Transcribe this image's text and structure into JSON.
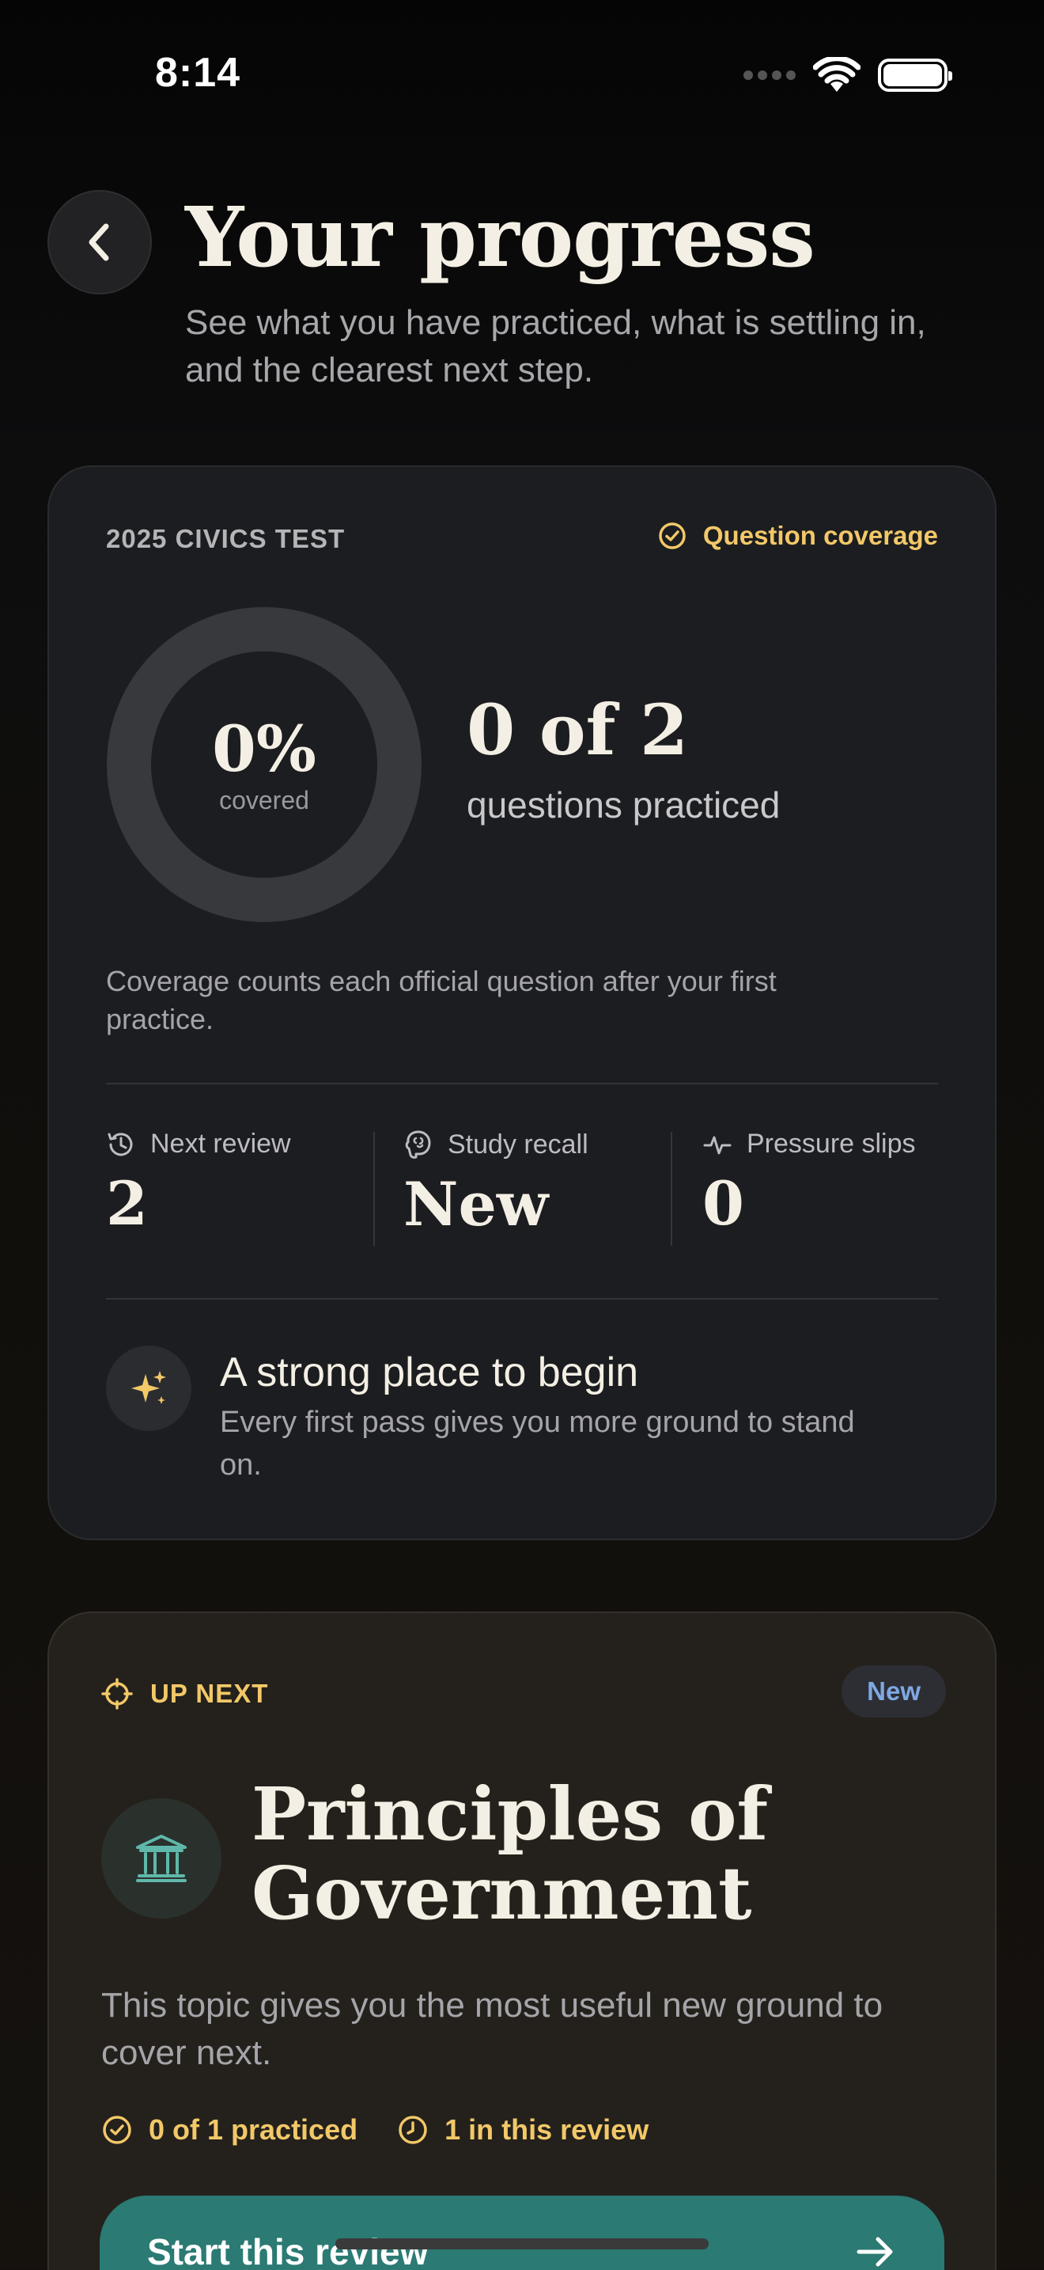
{
  "status_bar": {
    "time": "8:14"
  },
  "header": {
    "title": "Your progress",
    "subtitle": "See what you have practiced, what is settling in, and the clearest next step."
  },
  "progress_card": {
    "label": "2025 CIVICS TEST",
    "coverage_tag": "Question coverage",
    "ring": {
      "percent_text": "0%",
      "caption": "covered",
      "coverage_fraction": 0
    },
    "count": "0 of 2",
    "count_caption": "questions practiced",
    "note": "Coverage counts each official question after your first practice.",
    "stats": [
      {
        "label": "Next review",
        "value": "2",
        "icon": "history-icon"
      },
      {
        "label": "Study recall",
        "value": "New",
        "icon": "brain-icon"
      },
      {
        "label": "Pressure slips",
        "value": "0",
        "icon": "pulse-icon"
      }
    ],
    "encouragement": {
      "title": "A strong place to begin",
      "subtitle": "Every first pass gives you more ground to stand on.",
      "icon": "sparkle-icon"
    }
  },
  "next_card": {
    "label": "UP NEXT",
    "badge": "New",
    "topic_title": "Principles of Government",
    "topic_icon": "government-building-icon",
    "description": "This topic gives you the most useful new ground to cover next.",
    "meta": [
      {
        "text": "0 of 1 practiced",
        "icon": "check-circle-icon"
      },
      {
        "text": "1 in this review",
        "icon": "clock-icon"
      }
    ],
    "button_label": "Start this review"
  },
  "colors": {
    "accent_gold": "#f2c868",
    "accent_teal": "#2b7a73",
    "badge_blue": "#7fa7e3"
  }
}
